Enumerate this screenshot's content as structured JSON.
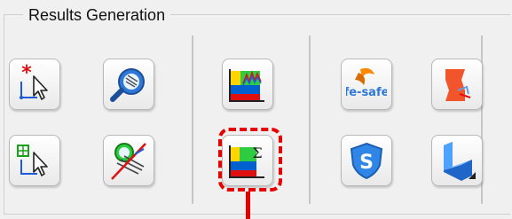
{
  "group": {
    "title": "Results Generation"
  },
  "buttons": [
    {
      "icon": "create-field-output-icon"
    },
    {
      "icon": "probe-search-icon"
    },
    {
      "icon": "xy-plot-icon"
    },
    {
      "icon": "fe-safe-icon",
      "label": "fe-safe"
    },
    {
      "icon": "tosca-icon"
    },
    {
      "icon": "create-xy-data-table-icon"
    },
    {
      "icon": "probe-crossed-icon"
    },
    {
      "icon": "sum-contour-icon",
      "label": "Σ"
    },
    {
      "icon": "isight-shield-icon",
      "label": "S"
    },
    {
      "icon": "3d-l-shape-icon"
    }
  ],
  "highlight": {
    "color": "#e60000",
    "target": "sum-contour-button"
  }
}
